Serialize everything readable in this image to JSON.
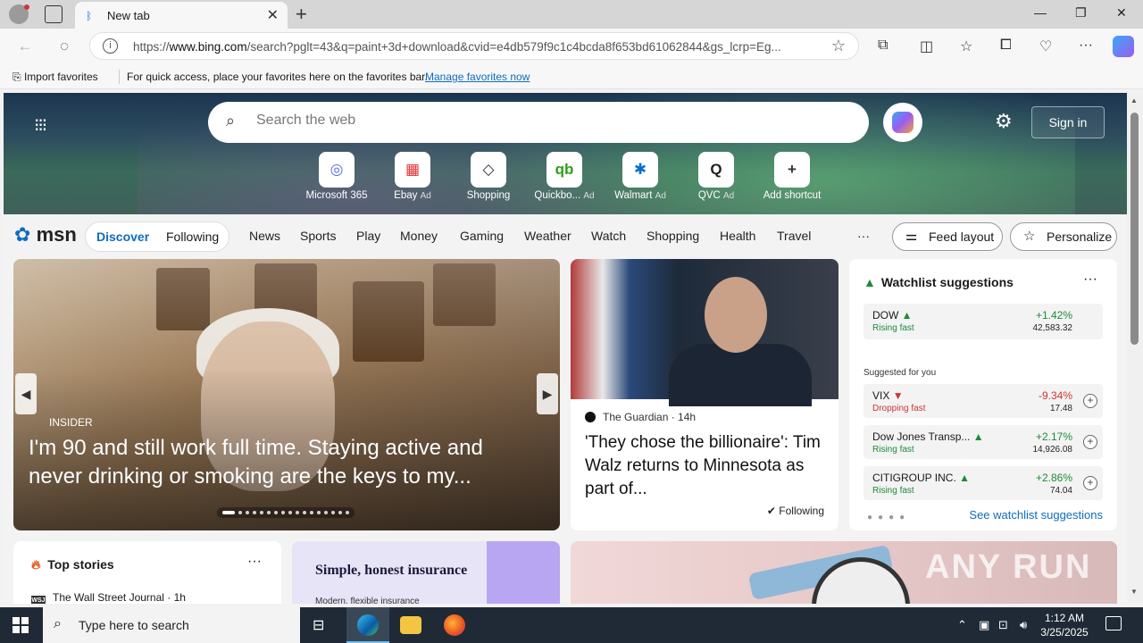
{
  "browser": {
    "tab_title": "New tab",
    "url_prefix": "https://",
    "url_domain": "www.bing.com",
    "url_rest": "/search?pglt=43&q=paint+3d+download&cvid=e4db579f9c1c4bcda8f653bd61062844&gs_lcrp=Eg...",
    "favorites_bar": {
      "import_label": "Import favorites",
      "message": "For quick access, place your favorites here on the favorites bar.",
      "manage_link": "Manage favorites now"
    }
  },
  "newtab": {
    "search_placeholder": "Search the web",
    "sign_in": "Sign in",
    "shortcuts": [
      {
        "label": "Microsoft 365",
        "ad": "",
        "glyph": "◎",
        "color": "#5b6ee0"
      },
      {
        "label": "Ebay",
        "ad": "Ad",
        "glyph": "▦",
        "color": "#e53238"
      },
      {
        "label": "Shopping",
        "ad": "",
        "glyph": "◇",
        "color": "#333333"
      },
      {
        "label": "Quickbo...",
        "ad": "Ad",
        "glyph": "qb",
        "color": "#2ca01c"
      },
      {
        "label": "Walmart",
        "ad": "Ad",
        "glyph": "✱",
        "color": "#0071ce"
      },
      {
        "label": "QVC",
        "ad": "Ad",
        "glyph": "Q",
        "color": "#222222"
      },
      {
        "label": "Add shortcut",
        "ad": "",
        "glyph": "+",
        "color": "#333333"
      }
    ]
  },
  "msn": {
    "logo": "msn",
    "discover": "Discover",
    "following": "Following",
    "nav": [
      "News",
      "Sports",
      "Play",
      "Money",
      "Gaming",
      "Weather",
      "Watch",
      "Shopping",
      "Health",
      "Travel"
    ],
    "more": "···",
    "feed_layout": "Feed layout",
    "personalize": "Personalize"
  },
  "feature": {
    "source": "INSIDER",
    "headline": "I'm 90 and still work full time. Staying active and never drinking or smoking are the keys to my..."
  },
  "news": {
    "source": "The Guardian · 14h",
    "headline": "'They chose the billionaire': Tim Walz returns to Minnesota as part of...",
    "following": "Following"
  },
  "watchlist": {
    "title": "Watchlist suggestions",
    "more": "···",
    "suggested_label": "Suggested for you",
    "see_all": "See watchlist suggestions",
    "items": [
      {
        "name": "DOW",
        "trend": "Rising fast",
        "change": "+1.42%",
        "value": "42,583.32",
        "dir": "up"
      },
      {
        "name": "VIX",
        "trend": "Dropping fast",
        "change": "-9.34%",
        "value": "17.48",
        "dir": "down"
      },
      {
        "name": "Dow Jones Transp...",
        "trend": "Rising fast",
        "change": "+2.17%",
        "value": "14,926.08",
        "dir": "up"
      },
      {
        "name": "CITIGROUP INC.",
        "trend": "Rising fast",
        "change": "+2.86%",
        "value": "74.04",
        "dir": "up"
      }
    ]
  },
  "top_stories": {
    "title": "Top stories",
    "more": "···",
    "source": "The Wall Street Journal · 1h",
    "source_badge": "WSJ"
  },
  "ad_card": {
    "title": "Simple, honest insurance",
    "subtitle": "Modern, flexible insurance"
  },
  "watermark": "ANY RUN",
  "taskbar": {
    "search_placeholder": "Type here to search",
    "time": "1:12 AM",
    "date": "3/25/2025"
  }
}
